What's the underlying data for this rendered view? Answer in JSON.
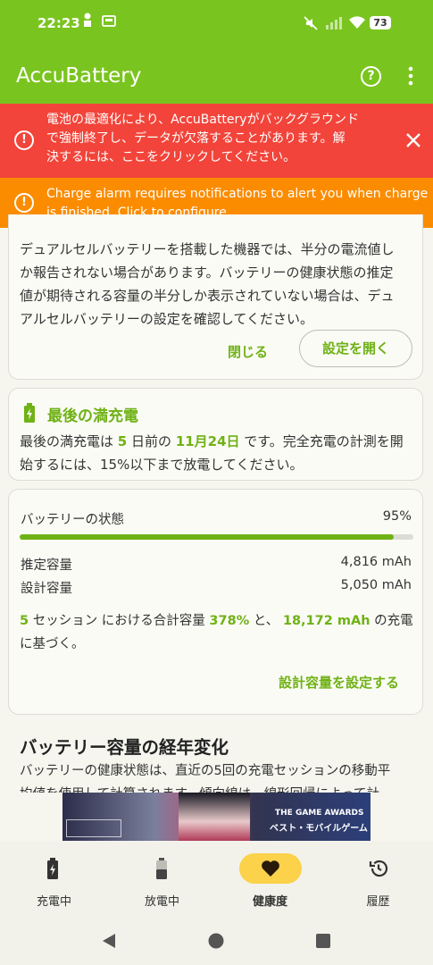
{
  "status_bar": {
    "time": "22:23",
    "battery": "73"
  },
  "app_bar": {
    "title": "AccuBattery"
  },
  "warning_optimization": {
    "text": "電池の最適化により、AccuBatteryがバックグラウンドで強制終了し、データが欠落することがあります。解決するには、ここをクリックしてください。",
    "line1": "電池の最適化により、AccuBatteryがバックグラウンド",
    "line2": "で強制終了し、データが欠落することがあります。解",
    "line3": "決するには、ここをクリックしてください。"
  },
  "warning_alarm": {
    "line1": "Charge alarm requires notifications to alert you when charge",
    "line2": "is finished. Click to configure."
  },
  "dual_cell_card": {
    "line1": "デュアルセルバッテリーを搭載した機器では、半分の電流値し",
    "line2": "か報告されない場合があります。バッテリーの健康状態の推定",
    "line3": "値が期待される容量の半分しか表示されていない場合は、デュ",
    "line4": "アルセルバッテリーの設定を確認してください。",
    "close_label": "閉じる",
    "open_settings_label": "設定を開く"
  },
  "last_full_charge": {
    "title": "最後の満充電",
    "l1_a": "最後の満充電は ",
    "days": "5",
    "l1_b": " 日前の ",
    "date": "11月24日",
    "l1_c": " です。完全充電の計測を開",
    "line2": "始するには、15%以下まで放電してください。"
  },
  "battery_health": {
    "label": "バッテリーの状態",
    "percent_text": "95%",
    "estimated_label": "推定容量",
    "estimated_value": "4,816 mAh",
    "design_label": "設計容量",
    "design_value": "5,050 mAh",
    "sessions": "5",
    "s_a": " セッション における合計容量 ",
    "total_pct": "378%",
    "s_b": " と、 ",
    "total_mah": "18,172 mAh",
    "s_c": " の充電",
    "s_line2": "に基づく。",
    "set_design_label": "設計容量を設定する"
  },
  "capacity_section": {
    "title": "バッテリー容量の経年変化",
    "line1": "バッテリーの健康状態は、直近の5回の充電セッションの移動平",
    "line2": "均値を使用して計算されます。傾向線は、線形回帰によって計"
  },
  "bottom_nav": [
    {
      "label": "充電中",
      "icon": "battery-charging-icon"
    },
    {
      "label": "放電中",
      "icon": "battery-icon"
    },
    {
      "label": "健康度",
      "icon": "heart-icon",
      "active": true
    },
    {
      "label": "履歴",
      "icon": "history-icon"
    }
  ],
  "ad": {
    "text": "THE GAME AWARDS",
    "text2": "ベスト・モバイルゲーム"
  },
  "colors": {
    "accent": "#7ac41f",
    "error": "#f2443a",
    "warning": "#fb8c00",
    "green_text": "#6fb215"
  },
  "health_progress": 0.95
}
